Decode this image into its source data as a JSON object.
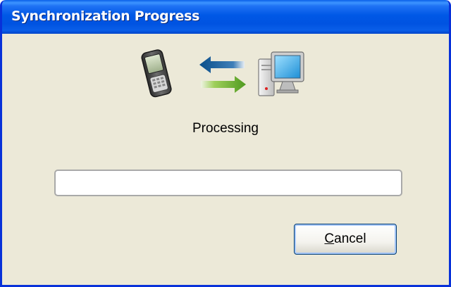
{
  "window": {
    "title": "Synchronization Progress"
  },
  "icons": {
    "device": "handheld-device-icon",
    "sync": "sync-arrows-icon",
    "computer": "desktop-computer-icon"
  },
  "status": {
    "text": "Processing"
  },
  "progress": {
    "value_percent": 0
  },
  "buttons": {
    "cancel_label": "Cancel",
    "cancel_mnemonic": "C",
    "cancel_rest": "ancel"
  },
  "colors": {
    "title_bar": "#0058e6",
    "window_frame": "#0831d9",
    "dialog_bg": "#ece9d8",
    "arrow_left": "#0b4f8a",
    "arrow_right": "#5aa128"
  }
}
